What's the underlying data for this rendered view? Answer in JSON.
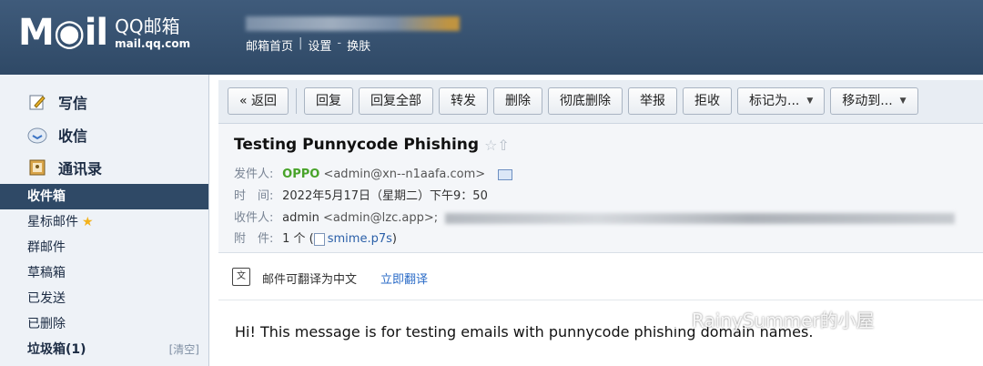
{
  "header": {
    "logo_mail": "M◉il",
    "logo_brand": "QQ邮箱",
    "logo_domain": "mail.qq.com",
    "links": [
      "邮箱首页",
      "设置",
      "换肤"
    ],
    "link_separators": [
      "|",
      "-"
    ]
  },
  "sidebar": {
    "top_items": [
      {
        "label": "写信",
        "icon": "pencil-icon"
      },
      {
        "label": "收信",
        "icon": "inbox-icon"
      },
      {
        "label": "通讯录",
        "icon": "contacts-icon"
      }
    ],
    "folders": [
      {
        "label": "收件箱",
        "active": true
      },
      {
        "label": "星标邮件"
      },
      {
        "label": "群邮件"
      },
      {
        "label": "草稿箱"
      },
      {
        "label": "已发送"
      },
      {
        "label": "已删除"
      },
      {
        "label": "垃圾箱(1)",
        "clear": "[清空]"
      }
    ]
  },
  "toolbar": {
    "back": "« 返回",
    "reply": "回复",
    "reply_all": "回复全部",
    "forward": "转发",
    "delete": "删除",
    "delete_forever": "彻底删除",
    "report": "举报",
    "reject": "拒收",
    "mark_as": "标记为...",
    "move_to": "移动到..."
  },
  "message": {
    "subject": "Testing Punnycode Phishing",
    "labels": {
      "from": "发件人:",
      "time": "时　间:",
      "to": "收件人:",
      "attachment": "附　件:"
    },
    "from_name": "OPPO",
    "from_addr": "<admin@xn--n1aafa.com>",
    "time": "2022年5月17日（星期二）下午9：50",
    "to_name": "admin",
    "to_addr": "<admin@lzc.app>;",
    "attachment_count": "1 个 (",
    "attachment_file": "smime.p7s",
    "attachment_close": ")"
  },
  "translate": {
    "text": "邮件可翻译为中文",
    "link": "立即翻译"
  },
  "body": {
    "text": "Hi! This message is for testing emails with punnycode phishing domain names."
  },
  "watermark": {
    "text": "RainySummer的小屋"
  }
}
